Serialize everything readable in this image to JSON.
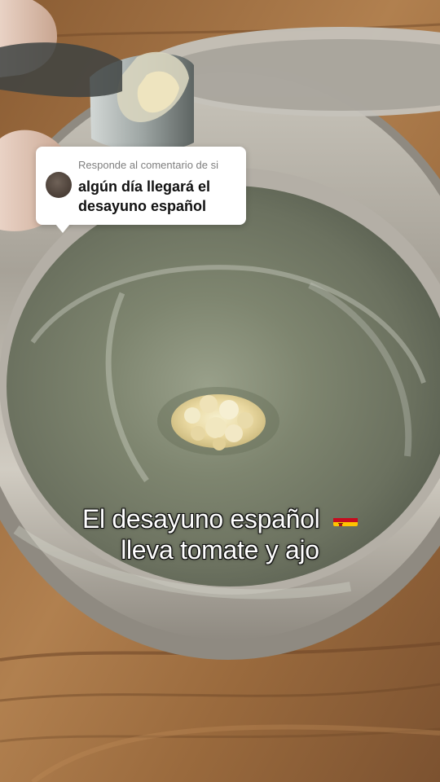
{
  "reply": {
    "header": "Responde al comentario de si",
    "comment": "algún día llegará el desayuno español"
  },
  "caption": {
    "line1": "El desayuno español",
    "line2": "lleva tomate y ajo",
    "flag_icon": "spain-flag-icon"
  },
  "colors": {
    "countertop": "#a87a4b",
    "pan": "#b7b2a9",
    "oil": "#8c8f78",
    "garlic": "#e8e0b2",
    "reply_bg": "#ffffff"
  }
}
